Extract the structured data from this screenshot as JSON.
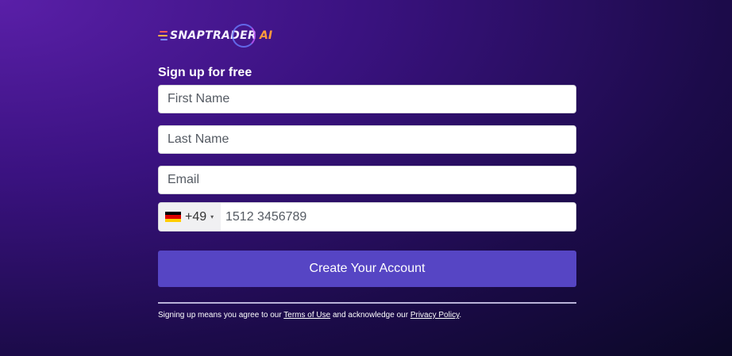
{
  "logo": {
    "brand": "SNAPTRADER",
    "suffix": "AI",
    "line_colors": [
      "#ff5a5a",
      "#ffb347",
      "#7c8cff"
    ]
  },
  "form": {
    "heading": "Sign up for free",
    "first_name_placeholder": "First Name",
    "last_name_placeholder": "Last Name",
    "email_placeholder": "Email",
    "phone": {
      "country_flag": "germany-flag",
      "dial_code": "+49",
      "caret": "▾",
      "placeholder": "1512 3456789"
    },
    "submit_label": "Create Your Account"
  },
  "legal": {
    "prefix": "Signing up means you agree to our",
    "terms_label": "Terms of Use",
    "middle": "and acknowledge our",
    "privacy_label": "Privacy Policy",
    "suffix": "."
  },
  "colors": {
    "button": "#5645c4",
    "background_start": "#5a1fa8",
    "background_end": "#0b0826"
  }
}
